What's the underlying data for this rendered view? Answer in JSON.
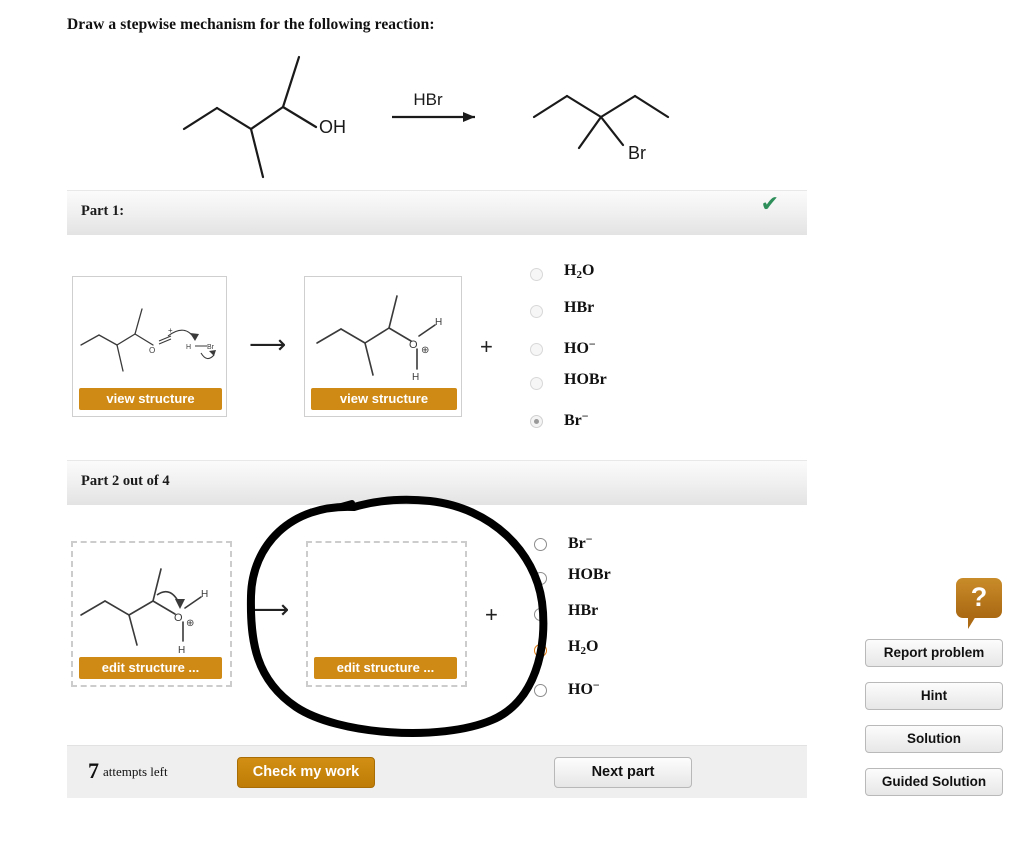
{
  "prompt": "Draw a stepwise mechanism for the following reaction:",
  "reaction": {
    "reagent_label": "HBr",
    "reactant_label": "OH",
    "product_label": "Br"
  },
  "part1": {
    "header": "Part 1:",
    "status_icon": "check-mark",
    "status_color": "#2f8f5b",
    "left_box_button": "view structure",
    "right_box_button": "view structure",
    "arrow": "⟶",
    "plus": "+",
    "structure_left_atoms": [
      "O",
      "+",
      "H",
      "Br"
    ],
    "structure_right_atoms": [
      "H",
      "O",
      "⊕",
      "H"
    ],
    "options": [
      {
        "label_html": "H<sub>2</sub>O",
        "selected": false
      },
      {
        "label_html": "HBr",
        "selected": false
      },
      {
        "label_html": "HO<sup>−</sup>",
        "selected": false
      },
      {
        "label_html": "HOBr",
        "selected": false
      },
      {
        "label_html": "Br<sup>−</sup>",
        "selected": true
      }
    ]
  },
  "part2": {
    "header": "Part 2 out of 4",
    "left_box_button": "edit structure ...",
    "right_box_button": "edit structure ...",
    "arrow": "⟶",
    "plus": "+",
    "structure_left_atoms": [
      "H",
      "O",
      "⊕",
      "H"
    ],
    "options": [
      {
        "label_html": "Br<sup>−</sup>",
        "selected": false
      },
      {
        "label_html": "HOBr",
        "selected": false
      },
      {
        "label_html": "HBr",
        "selected": false
      },
      {
        "label_html": "H<sub>2</sub>O",
        "selected": true
      },
      {
        "label_html": "HO<sup>−</sup>",
        "selected": false
      }
    ]
  },
  "annotation": {
    "type": "hand-drawn-circle",
    "color": "#000000"
  },
  "bottom": {
    "attempts_number": "7",
    "attempts_text": "attempts left",
    "check_button": "Check my work",
    "next_button": "Next part"
  },
  "sidebar": {
    "help_icon": "question-mark-bubble",
    "buttons": [
      {
        "label": "Report problem"
      },
      {
        "label": "Hint"
      },
      {
        "label": "Solution"
      },
      {
        "label": "Guided Solution"
      }
    ]
  },
  "colors": {
    "orange": "#cf8a16",
    "check_green": "#2f8f5b",
    "radio_selected": "#f08010"
  }
}
